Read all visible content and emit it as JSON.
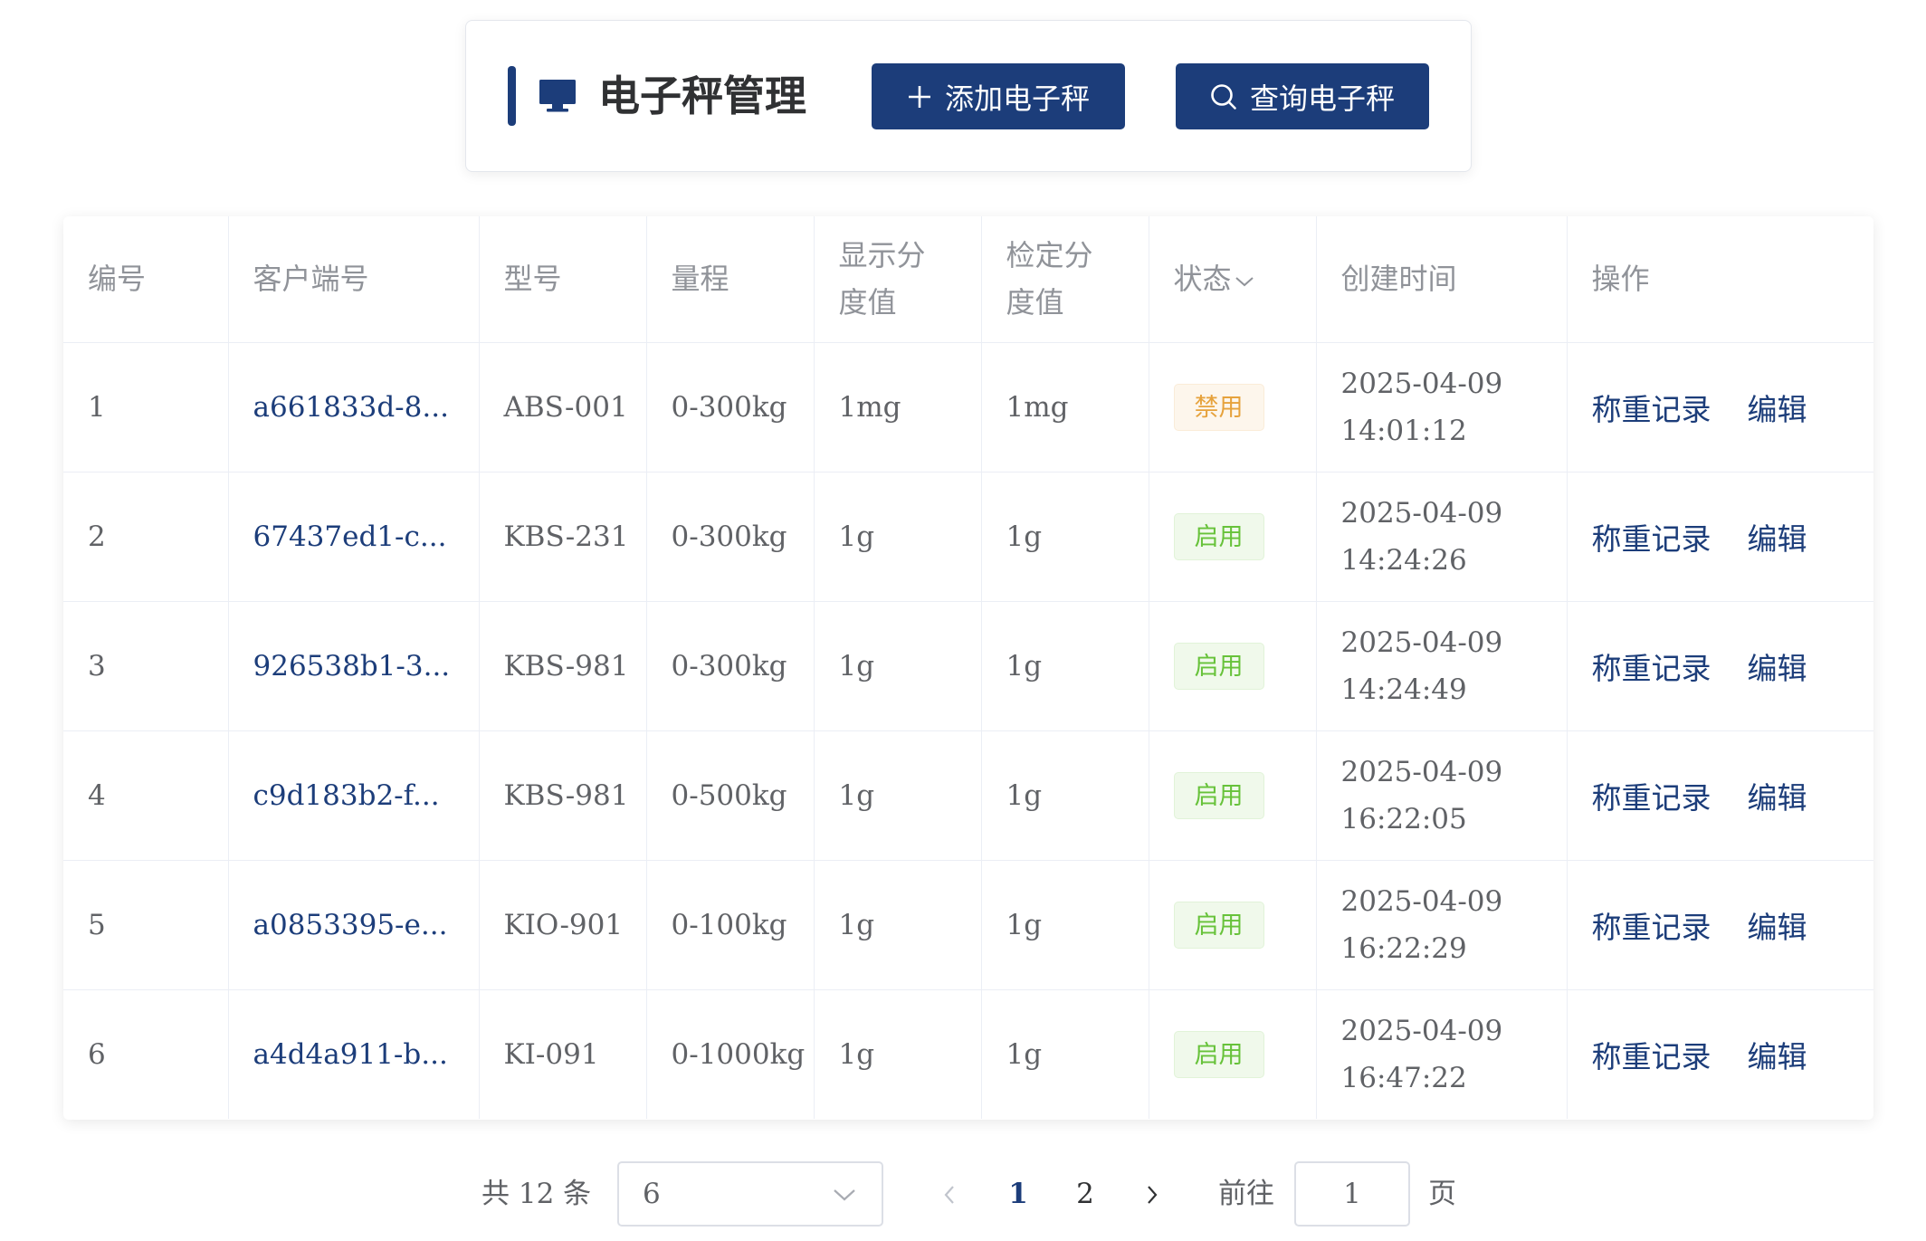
{
  "header": {
    "title": "电子秤管理",
    "icon": "monitor-icon",
    "add_button": "添加电子秤",
    "query_button": "查询电子秤",
    "accent_color": "#1c3d7a"
  },
  "table": {
    "columns": [
      "编号",
      "客户端号",
      "型号",
      "量程",
      "显示分度值",
      "检定分度值",
      "状态",
      "创建时间",
      "操作"
    ],
    "rows": [
      {
        "id": "1",
        "client": "a661833d-8...",
        "model": "ABS-001",
        "range": "0-300kg",
        "display_div": "1mg",
        "verify_div": "1mg",
        "status": "禁用",
        "date": "2025-04-09",
        "time": "14:01:12"
      },
      {
        "id": "2",
        "client": "67437ed1-c...",
        "model": "KBS-231",
        "range": "0-300kg",
        "display_div": "1g",
        "verify_div": "1g",
        "status": "启用",
        "date": "2025-04-09",
        "time": "14:24:26"
      },
      {
        "id": "3",
        "client": "926538b1-3...",
        "model": "KBS-981",
        "range": "0-300kg",
        "display_div": "1g",
        "verify_div": "1g",
        "status": "启用",
        "date": "2025-04-09",
        "time": "14:24:49"
      },
      {
        "id": "4",
        "client": "c9d183b2-f...",
        "model": "KBS-981",
        "range": "0-500kg",
        "display_div": "1g",
        "verify_div": "1g",
        "status": "启用",
        "date": "2025-04-09",
        "time": "16:22:05"
      },
      {
        "id": "5",
        "client": "a0853395-e...",
        "model": "KIO-901",
        "range": "0-100kg",
        "display_div": "1g",
        "verify_div": "1g",
        "status": "启用",
        "date": "2025-04-09",
        "time": "16:22:29"
      },
      {
        "id": "6",
        "client": "a4d4a911-b...",
        "model": "KI-091",
        "range": "0-1000kg",
        "display_div": "1g",
        "verify_div": "1g",
        "status": "启用",
        "date": "2025-04-09",
        "time": "16:47:22"
      }
    ],
    "actions": [
      "称重记录",
      "编辑"
    ],
    "status_colors": {
      "启用": "#67c23a",
      "禁用": "#e6a23c"
    }
  },
  "pagination": {
    "total_text": "共 12 条",
    "page_size": "6",
    "pages": [
      "1",
      "2"
    ],
    "current_page": "1",
    "goto_label": "前往",
    "goto_value": "1",
    "goto_suffix": "页"
  }
}
